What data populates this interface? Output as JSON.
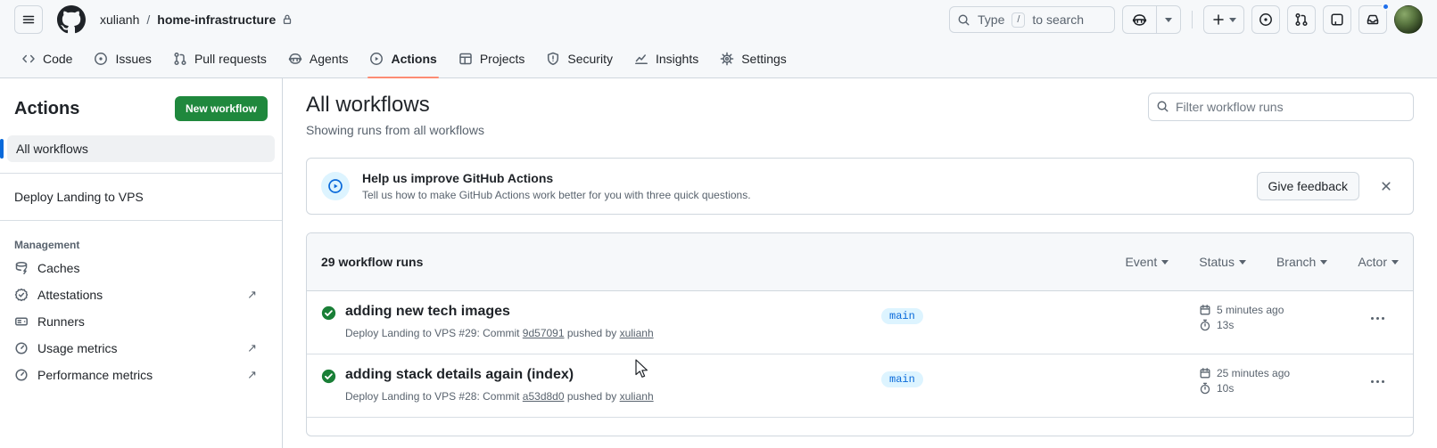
{
  "header": {
    "breadcrumb": {
      "owner": "xulianh",
      "separator": "/",
      "repo": "home-infrastructure"
    },
    "search": {
      "placeholder_prefix": "Type",
      "key": "/",
      "placeholder_suffix": "to search"
    }
  },
  "nav_tabs": [
    {
      "label": "Code",
      "active": false
    },
    {
      "label": "Issues",
      "active": false
    },
    {
      "label": "Pull requests",
      "active": false
    },
    {
      "label": "Agents",
      "active": false
    },
    {
      "label": "Actions",
      "active": true
    },
    {
      "label": "Projects",
      "active": false
    },
    {
      "label": "Security",
      "active": false
    },
    {
      "label": "Insights",
      "active": false
    },
    {
      "label": "Settings",
      "active": false
    }
  ],
  "sidebar": {
    "title": "Actions",
    "new_workflow_button": "New workflow",
    "selected_item": "All workflows",
    "workflow_links": [
      "Deploy Landing to VPS"
    ],
    "management": {
      "heading": "Management",
      "external_arrow": "↗",
      "items": [
        {
          "label": "Caches",
          "external": false
        },
        {
          "label": "Attestations",
          "external": true
        },
        {
          "label": "Runners",
          "external": false
        },
        {
          "label": "Usage metrics",
          "external": true
        },
        {
          "label": "Performance metrics",
          "external": true
        }
      ]
    }
  },
  "main": {
    "title": "All workflows",
    "subtitle": "Showing runs from all workflows",
    "filter_placeholder": "Filter workflow runs",
    "banner": {
      "title": "Help us improve GitHub Actions",
      "description": "Tell us how to make GitHub Actions work better for you with three quick questions.",
      "button_label": "Give feedback"
    },
    "runs_header": {
      "count_label": "29 workflow runs",
      "filters": [
        "Event",
        "Status",
        "Branch",
        "Actor"
      ]
    },
    "runs": [
      {
        "status": "success",
        "title": "adding new tech images",
        "detail_prefix": "Deploy Landing to VPS #29: Commit",
        "commit": "9d57091",
        "detail_mid": "pushed by",
        "actor": "xulianh",
        "branch": "main",
        "time": "5 minutes ago",
        "duration": "13s"
      },
      {
        "status": "success",
        "title": "adding stack details again (index)",
        "detail_prefix": "Deploy Landing to VPS #28: Commit",
        "commit": "a53d8d0",
        "detail_mid": "pushed by",
        "actor": "xulianh",
        "branch": "main",
        "time": "25 minutes ago",
        "duration": "10s"
      }
    ]
  },
  "colors": {
    "accent_blue": "#0969da",
    "success_green": "#1a7f37",
    "button_green": "#1f883d",
    "active_tab_underline": "#fd8c73",
    "branch_badge_bg": "#ddf4ff"
  }
}
